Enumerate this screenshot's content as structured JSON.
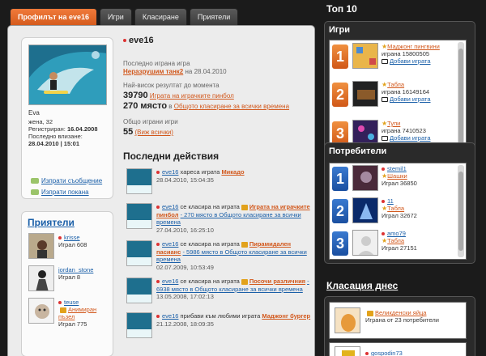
{
  "tabs": [
    "Профилът на eve16",
    "Игри",
    "Класиране",
    "Приятели"
  ],
  "profile": {
    "first_name": "Eva",
    "gender_age": "жена, 32",
    "registered_label": "Регистриран:",
    "registered": "16.04.2008",
    "last_login_label": "Последно влизане:",
    "last_login": "28.04.2010 | 15:01",
    "send_message": "Изпрати съобщение",
    "send_invite": "Изпрати покана"
  },
  "user": {
    "name": "eve16",
    "last_game_label": "Последно играна игра",
    "last_game": "Неразрушим танк2",
    "last_game_on": "на 28.04.2010",
    "best_label": "Най-висок резултат до момента",
    "best_score": "39790",
    "best_game": "Играта на играчките пинбол",
    "place": "270 място",
    "place_in": "в",
    "place_link": "Общото класиране за всички времена",
    "total_label": "Общо играни игри",
    "total": "55",
    "see_all": "(Виж всички)"
  },
  "activity_header": "Последни действия",
  "activities": [
    {
      "user": "eve16",
      "text": "хареса играта",
      "game": "Микадо",
      "extra": "",
      "date": "28.04.2010, 15:04:35"
    },
    {
      "user": "eve16",
      "text": "се класира на играта",
      "game": "Играта на играчките пинбол",
      "extra": "- 270 място в Общото класиране за всички времена",
      "date": "27.04.2010, 16:25:10"
    },
    {
      "user": "eve16",
      "text": "се класира на играта",
      "game": "Пирамидален пасианс",
      "extra": "- 5986 място в Общото класиране за всички времена",
      "date": "02.07.2009, 10:53:49"
    },
    {
      "user": "eve16",
      "text": "се класира на играта",
      "game": "Посочи различния",
      "extra": "- 6938 място в Общото класиране за всички времена",
      "date": "13.05.2008, 17:02:13"
    },
    {
      "user": "eve16",
      "text": "прибави към любими играта",
      "game": "Маджонг бургер",
      "extra": "",
      "date": "21.12.2008, 18:09:35"
    }
  ],
  "friends": {
    "title": "Приятели",
    "items": [
      {
        "name": "krisse",
        "stat": "Играл 608",
        "extra": ""
      },
      {
        "name": "jordan_stone",
        "stat": "Играл 8",
        "extra": ""
      },
      {
        "name": "teuse",
        "stat": "Играл 775",
        "extra": "Анимиран пъзел"
      }
    ]
  },
  "top10": {
    "title": "Топ 10",
    "games_title": "Игри",
    "games": [
      {
        "rank": "1",
        "name": "Маджонг пингвини",
        "played": "играна 15800505",
        "add": "Добави играта"
      },
      {
        "rank": "2",
        "name": "Табла",
        "played": "играна 16149164",
        "add": "Добави играта"
      },
      {
        "rank": "3",
        "name": "Тупи",
        "played": "играна 7410523",
        "add": "Добави играта"
      }
    ],
    "users_title": "Потребители",
    "users": [
      {
        "rank": "1",
        "name": "stemil1",
        "game": "Шашки",
        "played": "Играл 36850"
      },
      {
        "rank": "2",
        "name": "11",
        "game": "Табла",
        "played": "Играл 32672"
      },
      {
        "rank": "3",
        "name": "amo79",
        "game": "Табла",
        "played": "Играл 27151"
      }
    ]
  },
  "today": {
    "title": "Класация днес",
    "game": "Великденски яйца",
    "stat": "Играна от 23 потребители",
    "user": "gospodin73"
  }
}
